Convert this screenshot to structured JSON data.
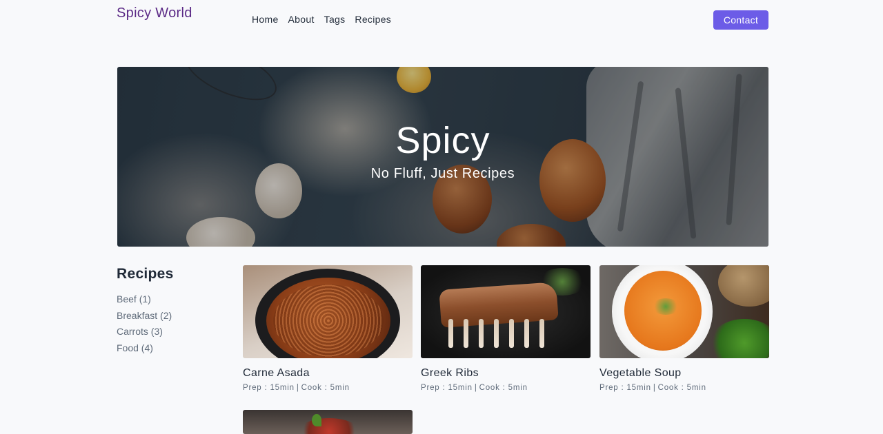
{
  "header": {
    "brand": "Spicy World",
    "nav": [
      "Home",
      "About",
      "Tags",
      "Recipes"
    ],
    "contact_label": "Contact",
    "accent_color": "#6c5ce7",
    "brand_color": "#5b2a86"
  },
  "hero": {
    "title": "Spicy",
    "subtitle": "No Fluff, Just Recipes"
  },
  "sidebar": {
    "heading": "Recipes",
    "tags": [
      "Beef (1)",
      "Breakfast (2)",
      "Carrots (3)",
      "Food (4)"
    ]
  },
  "recipes": [
    {
      "title": "Carne Asada",
      "prep": "Prep : 15min",
      "cook": "Cook : 5min"
    },
    {
      "title": "Greek Ribs",
      "prep": "Prep : 15min",
      "cook": "Cook : 5min"
    },
    {
      "title": "Vegetable Soup",
      "prep": "Prep : 15min",
      "cook": "Cook : 5min"
    }
  ]
}
